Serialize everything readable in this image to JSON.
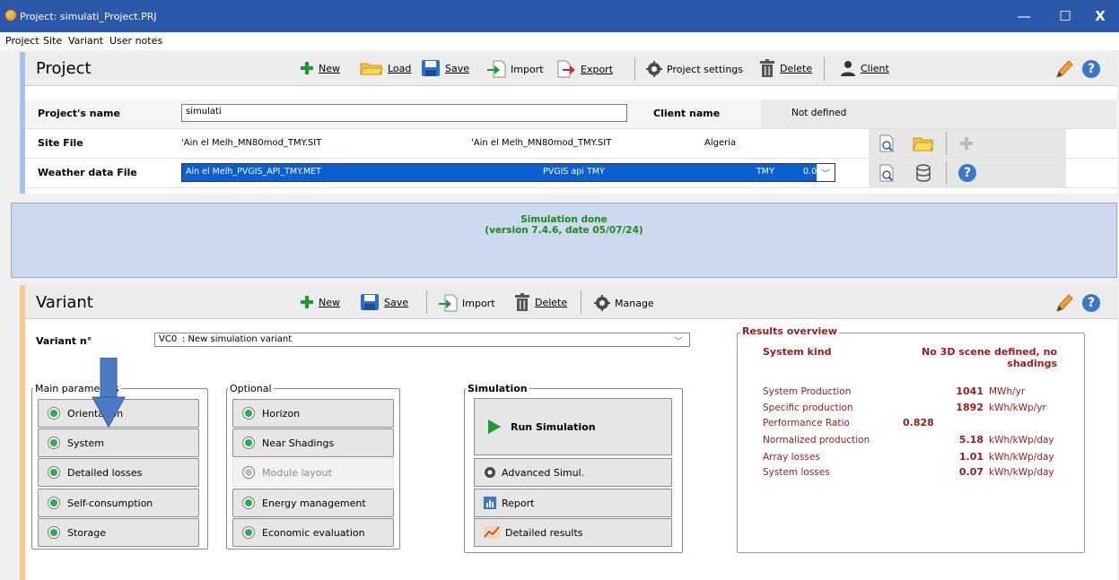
{
  "window": {
    "title": "Project: simulati_Project.PRJ",
    "minimize": "—",
    "maximize": "☐",
    "close": "X"
  },
  "menu": [
    "Project",
    "Site",
    "Variant",
    "User notes"
  ],
  "project": {
    "title": "Project",
    "toolbar": {
      "new": "New",
      "load": "Load",
      "save": "Save",
      "import": "Import",
      "export": "Export",
      "settings": "Project settings",
      "delete": "Delete",
      "client": "Client"
    },
    "name_label": "Project's name",
    "name_value": "simulati",
    "client_label": "Client name",
    "client_value": "Not defined",
    "site_label": "Site File",
    "site_file": "'Ain el Melh_MN80mod_TMY.SIT",
    "site_file2": "'Ain el Melh_MN80mod_TMY.SIT",
    "site_country": "Algeria",
    "weather_label": "Weather data File",
    "weather_file": "Ain el Melh_PVGIS_API_TMY.MET",
    "weather_source": "PVGIS api TMY",
    "weather_type": "TMY",
    "weather_extra": "0.0"
  },
  "status": {
    "line1": "Simulation done",
    "line2": "(version 7.4.6, date 05/07/24)"
  },
  "variant": {
    "title": "Variant",
    "toolbar": {
      "new": "New",
      "save": "Save",
      "import": "Import",
      "delete": "Delete",
      "manage": "Manage"
    },
    "number_label": "Variant n°",
    "number_code": "VC0",
    "number_desc": ": New simulation variant",
    "main_group": "Main parameters",
    "main_buttons": [
      "Orientation",
      "System",
      "Detailed losses",
      "Self-consumption",
      "Storage"
    ],
    "optional_group": "Optional",
    "optional_buttons": [
      "Horizon",
      "Near Shadings",
      "Module layout",
      "Energy management",
      "Economic evaluation"
    ],
    "simulation_group": "Simulation",
    "run": "Run Simulation",
    "advanced": "Advanced Simul.",
    "report": "Report",
    "detailed": "Detailed results"
  },
  "results": {
    "title": "Results overview",
    "kind_label": "System kind",
    "kind_value1": "No 3D scene defined, no",
    "kind_value2": "shadings",
    "rows": [
      {
        "label": "System Production",
        "value": "1041",
        "unit": "MWh/yr"
      },
      {
        "label": "Specific production",
        "value": "1892",
        "unit": "kWh/kWp/yr"
      },
      {
        "label": "Performance Ratio",
        "value": "0.828",
        "unit": ""
      },
      {
        "label": "Normalized production",
        "value": "5.18",
        "unit": "kWh/kWp/day"
      },
      {
        "label": "Array losses",
        "value": "1.01",
        "unit": "kWh/kWp/day"
      },
      {
        "label": "System losses",
        "value": "0.07",
        "unit": "kWh/kWp/day"
      }
    ]
  },
  "colors": {
    "titlebar": "#2b58a8",
    "status_text": "#1a8a1a",
    "results_text": "#9b1a1a",
    "arrow": "#4a7bc4"
  }
}
